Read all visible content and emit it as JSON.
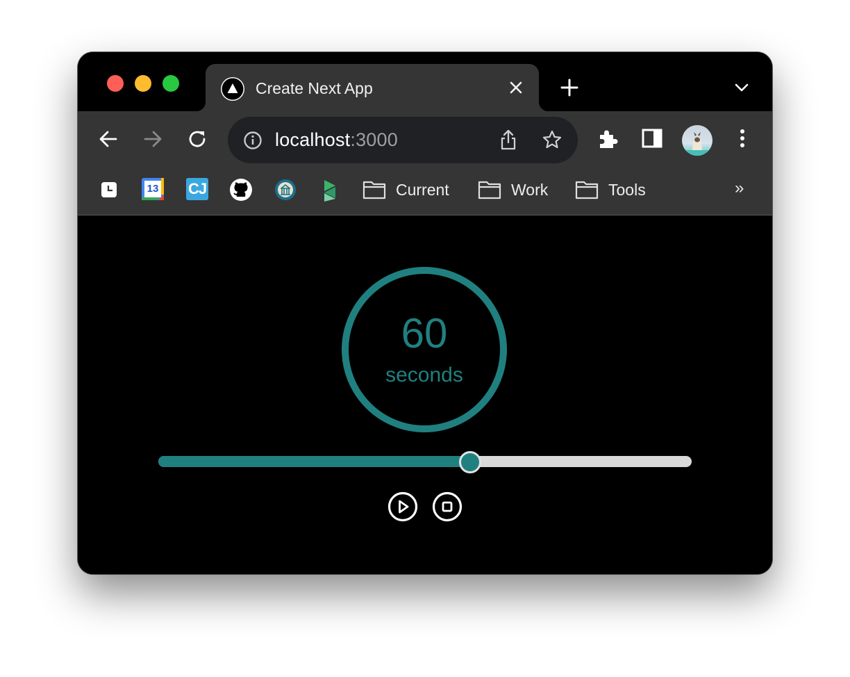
{
  "browser": {
    "tab": {
      "title": "Create Next App",
      "favicon": "nextjs-triangle-icon"
    },
    "address": {
      "host": "localhost",
      "port": ":3000"
    },
    "toolbar_icons": [
      "back-arrow-icon",
      "forward-arrow-icon",
      "reload-icon",
      "site-info-icon",
      "share-icon",
      "bookmark-star-icon",
      "extensions-puzzle-icon",
      "side-panel-icon",
      "profile-avatar",
      "kebab-menu-icon"
    ],
    "bookmarks": {
      "icons": [
        "clock-app-icon",
        "google-calendar-icon",
        "cj-icon",
        "github-icon",
        "globe-building-icon",
        "green-layers-icon"
      ],
      "calendar_day": "13",
      "cj_text": "CJ",
      "folders": [
        {
          "label": "Current"
        },
        {
          "label": "Work"
        },
        {
          "label": "Tools"
        }
      ],
      "overflow": "»"
    }
  },
  "timer": {
    "value": "60",
    "unit": "seconds",
    "ring_color": "#208080",
    "slider_fraction": 0.6,
    "controls": [
      "play-icon",
      "stop-icon"
    ]
  },
  "colors": {
    "accent": "#208080",
    "traffic_close": "#ff5f57",
    "traffic_minimize": "#febc2e",
    "traffic_maximize": "#28c840"
  }
}
